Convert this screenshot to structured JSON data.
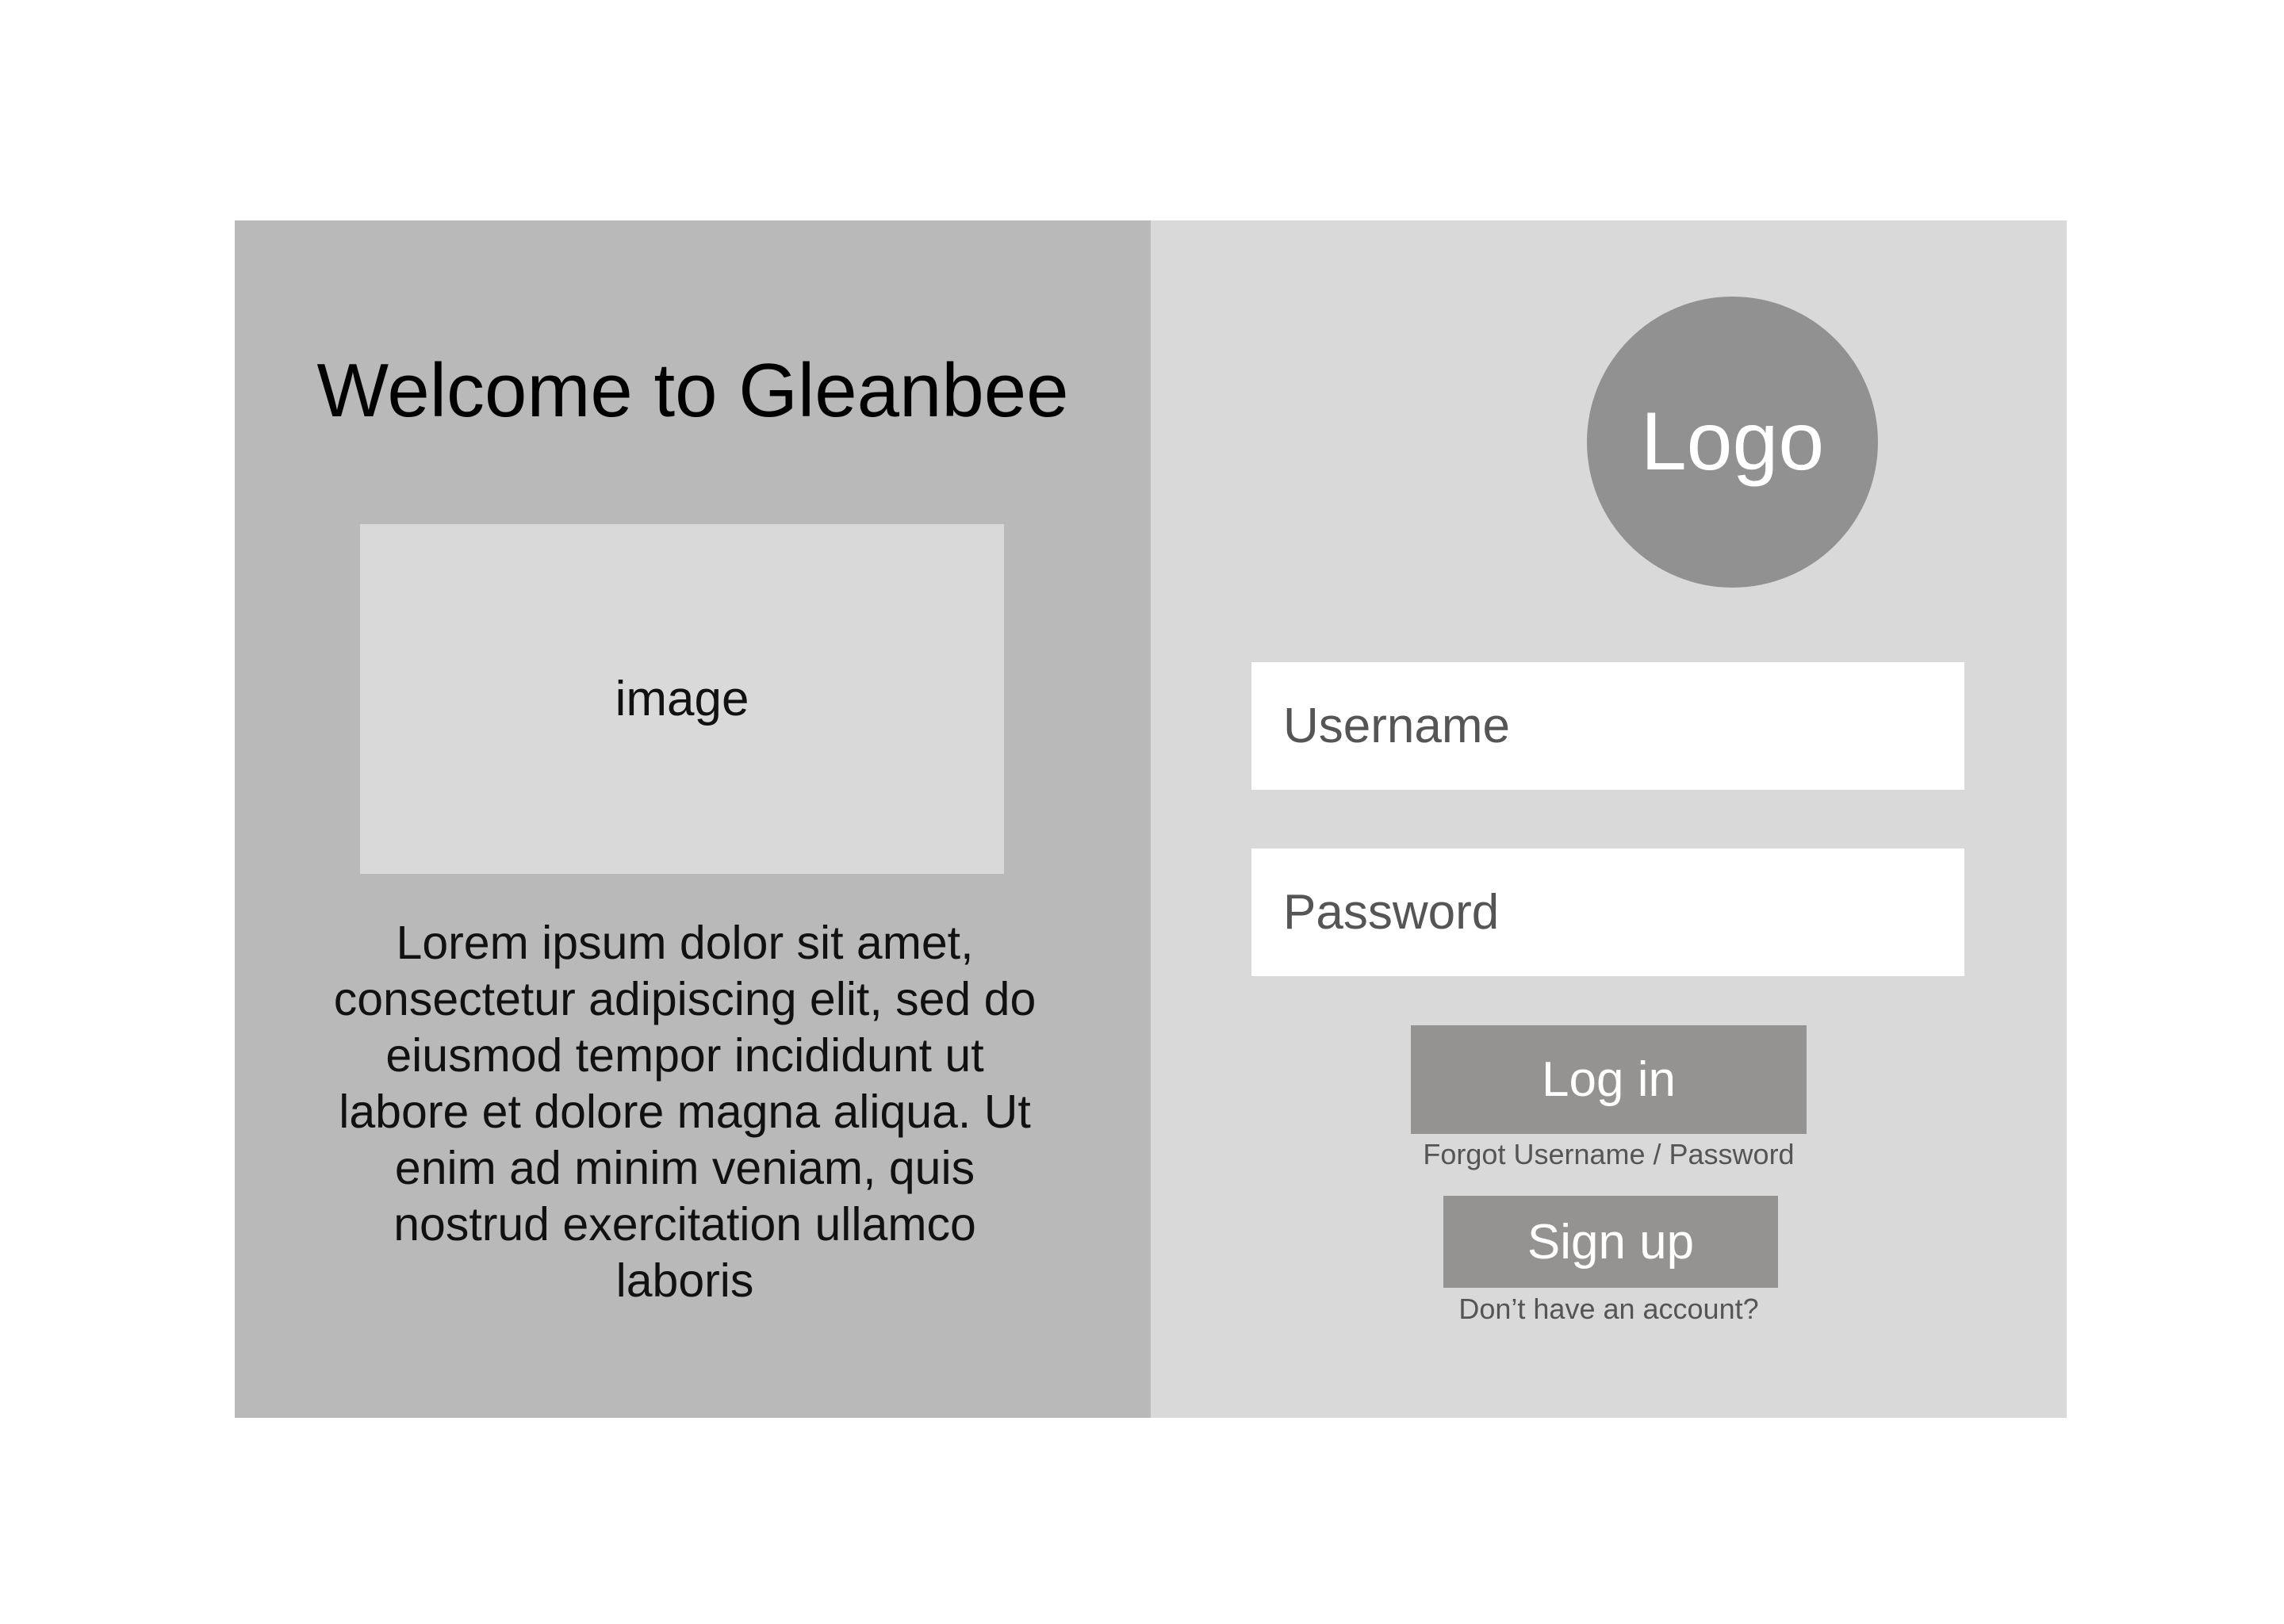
{
  "welcome": {
    "title": "Welcome to Gleanbee",
    "image_label": "image",
    "description": "Lorem ipsum dolor sit amet, consectetur adipiscing elit, sed do eiusmod tempor incididunt ut labore et dolore magna aliqua. Ut enim ad minim veniam, quis nostrud exercitation ullamco laboris"
  },
  "login": {
    "logo_text": "Logo",
    "username_placeholder": "Username",
    "password_placeholder": "Password",
    "login_label": "Log in",
    "forgot_link": "Forgot Username / Password",
    "signup_label": "Sign up",
    "no_account_text": "Don’t have an account?"
  },
  "colors": {
    "left_panel_bg": "#b9b9b9",
    "right_panel_bg": "#d9d9d9",
    "logo_circle": "#929191",
    "button_bg": "#949392",
    "page_bg": "#ffffff"
  }
}
